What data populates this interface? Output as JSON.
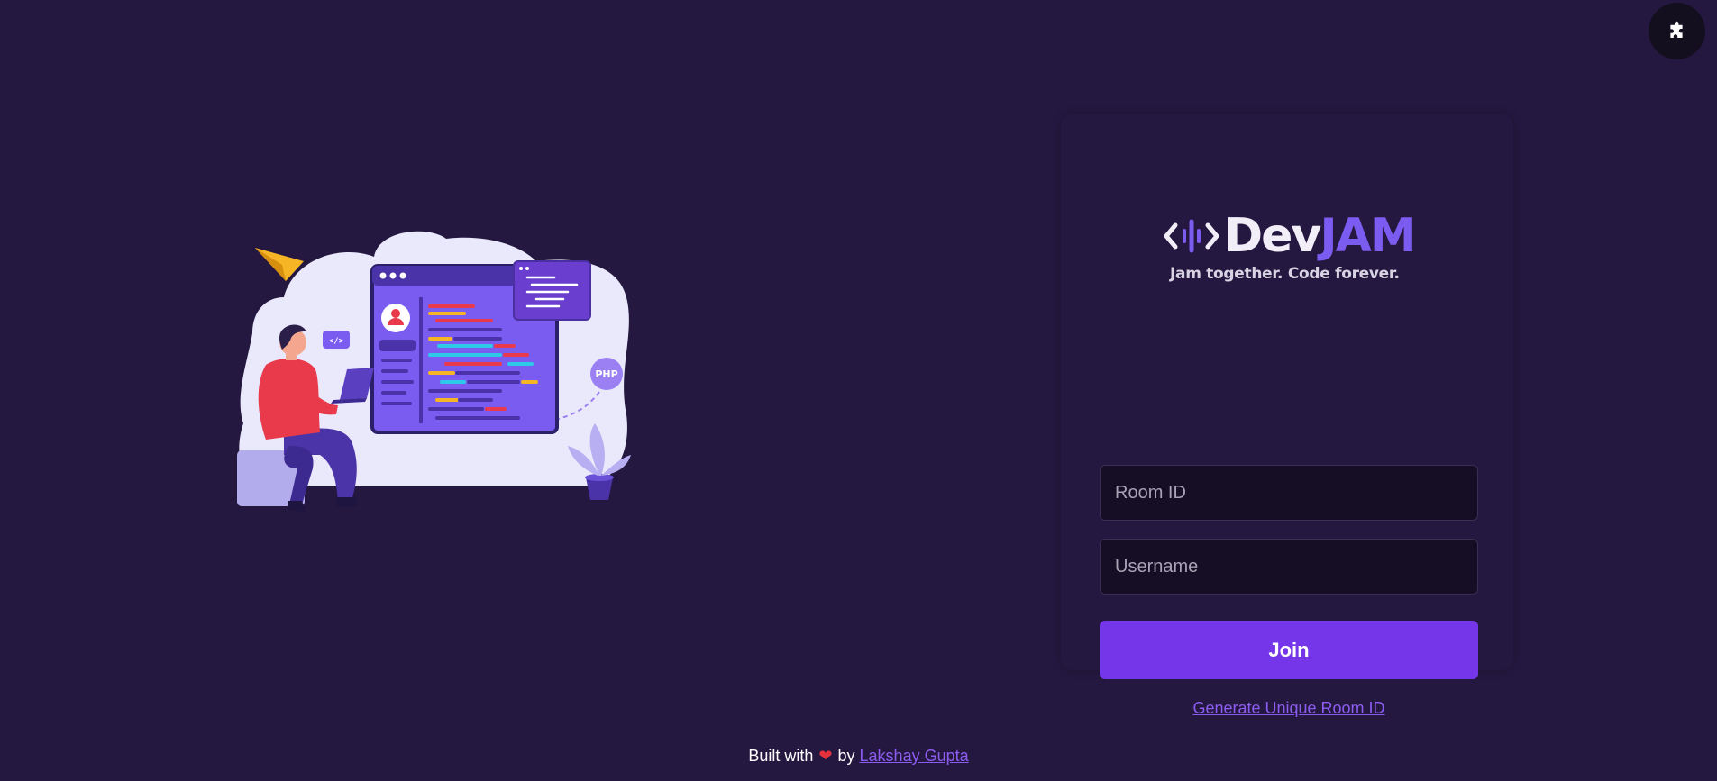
{
  "corner_button": {
    "icon": "puzzle-icon"
  },
  "illustration": {
    "chat_badge": "</>",
    "php_badge": "PHP"
  },
  "logo": {
    "dev": "Dev",
    "jam": "JAM",
    "tagline": "Jam together. Code forever."
  },
  "form": {
    "room_placeholder": "Room ID",
    "room_value": "",
    "username_placeholder": "Username",
    "username_value": "",
    "join_label": "Join",
    "generate_link": "Generate Unique Room ID"
  },
  "footer": {
    "prefix": "Built with",
    "heart": "❤",
    "by": "by",
    "author": "Lakshay Gupta"
  },
  "colors": {
    "background": "#251840",
    "accent": "#7535e8",
    "link": "#8c5cf0",
    "logo_jam": "#7b5cf0"
  }
}
